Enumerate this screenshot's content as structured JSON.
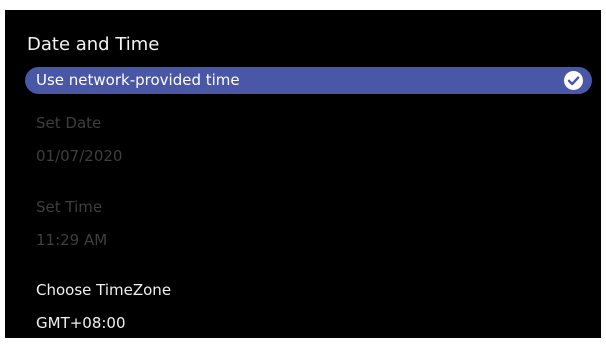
{
  "page": {
    "title": "Date and Time"
  },
  "network_time": {
    "label": "Use network-provided time",
    "checked": true,
    "icon": "checkmark-icon",
    "accent_color": "#4a56a6"
  },
  "set_date": {
    "label": "Set Date",
    "value": "01/07/2020",
    "enabled": false
  },
  "set_time": {
    "label": "Set Time",
    "value": "11:29 AM",
    "enabled": false
  },
  "timezone": {
    "label": "Choose TimeZone",
    "value": "GMT+08:00",
    "enabled": true
  }
}
